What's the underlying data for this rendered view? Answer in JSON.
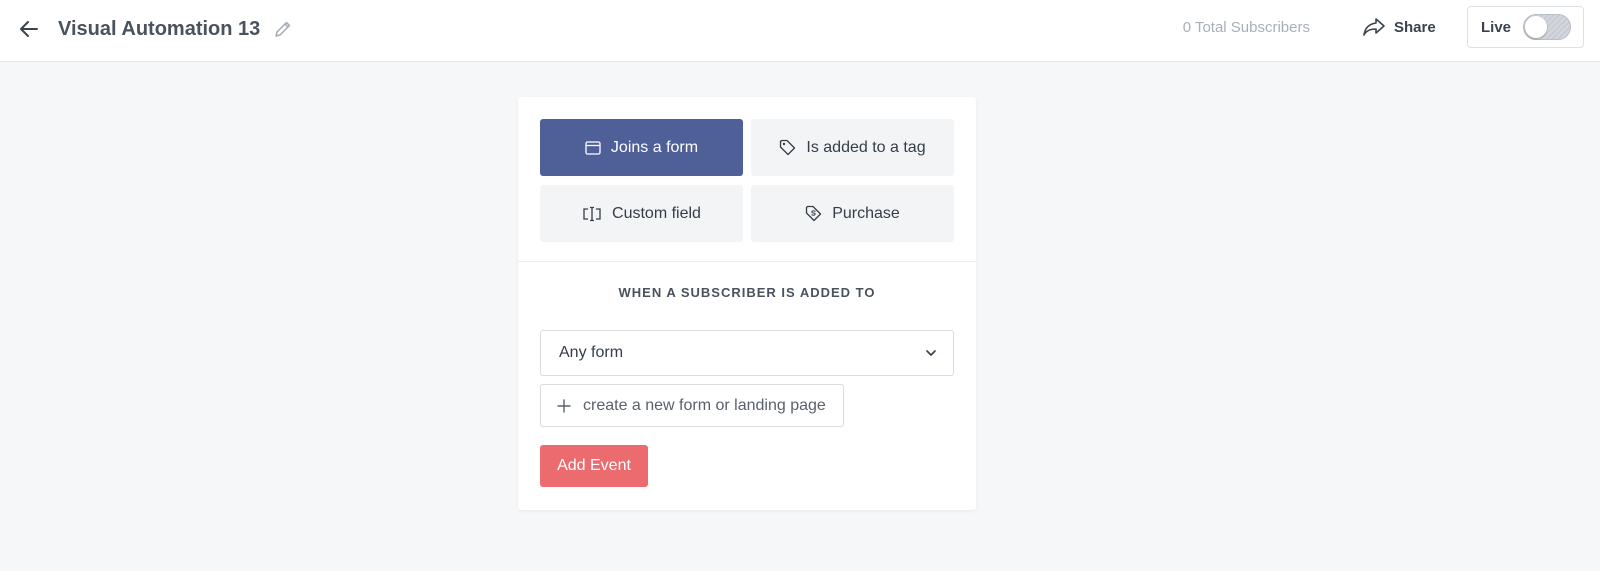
{
  "header": {
    "title": "Visual Automation 13",
    "subscribers": "0 Total Subscribers",
    "share_label": "Share",
    "live_label": "Live",
    "live_enabled": false
  },
  "triggers": [
    {
      "label": "Joins a form",
      "icon": "form-window-icon",
      "active": true
    },
    {
      "label": "Is added to a tag",
      "icon": "tag-icon",
      "active": false
    },
    {
      "label": "Custom field",
      "icon": "text-cursor-icon",
      "active": false
    },
    {
      "label": "Purchase",
      "icon": "price-tag-icon",
      "active": false
    }
  ],
  "section_label": "WHEN A SUBSCRIBER IS ADDED TO",
  "form_select": {
    "value": "Any form"
  },
  "create_link": "create a new form or landing page",
  "add_event_label": "Add Event",
  "colors": {
    "active_trigger": "#4f5f98",
    "add_event": "#ec6b6e",
    "background": "#f6f7f9"
  }
}
